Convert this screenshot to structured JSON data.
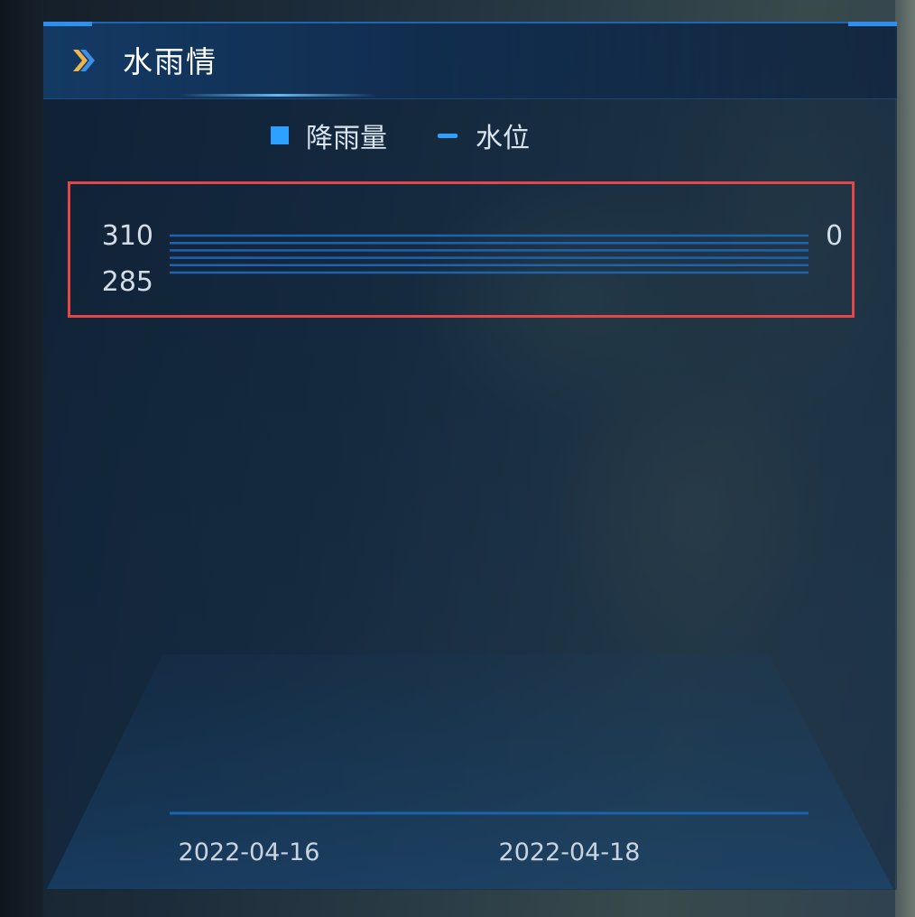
{
  "panel": {
    "title": "水雨情",
    "icon": "double-chevron-right-icon",
    "colors": {
      "accent": "#2ea0ff",
      "header_bar": "#1c66b8",
      "highlight": "#e54646"
    }
  },
  "legend": {
    "rainfall_label": "降雨量",
    "water_level_label": "水位"
  },
  "chart_data": {
    "type": "bar",
    "title": "",
    "series": [
      {
        "name": "降雨量",
        "type": "bar",
        "values": []
      },
      {
        "name": "水位",
        "type": "line",
        "values": []
      }
    ],
    "x": [
      "2022-04-16",
      "2022-04-18"
    ],
    "left_axis": {
      "ticks": [
        "310",
        "285"
      ]
    },
    "right_axis": {
      "ticks": [
        "0"
      ]
    },
    "grid": true,
    "legend_position": "top-center"
  }
}
